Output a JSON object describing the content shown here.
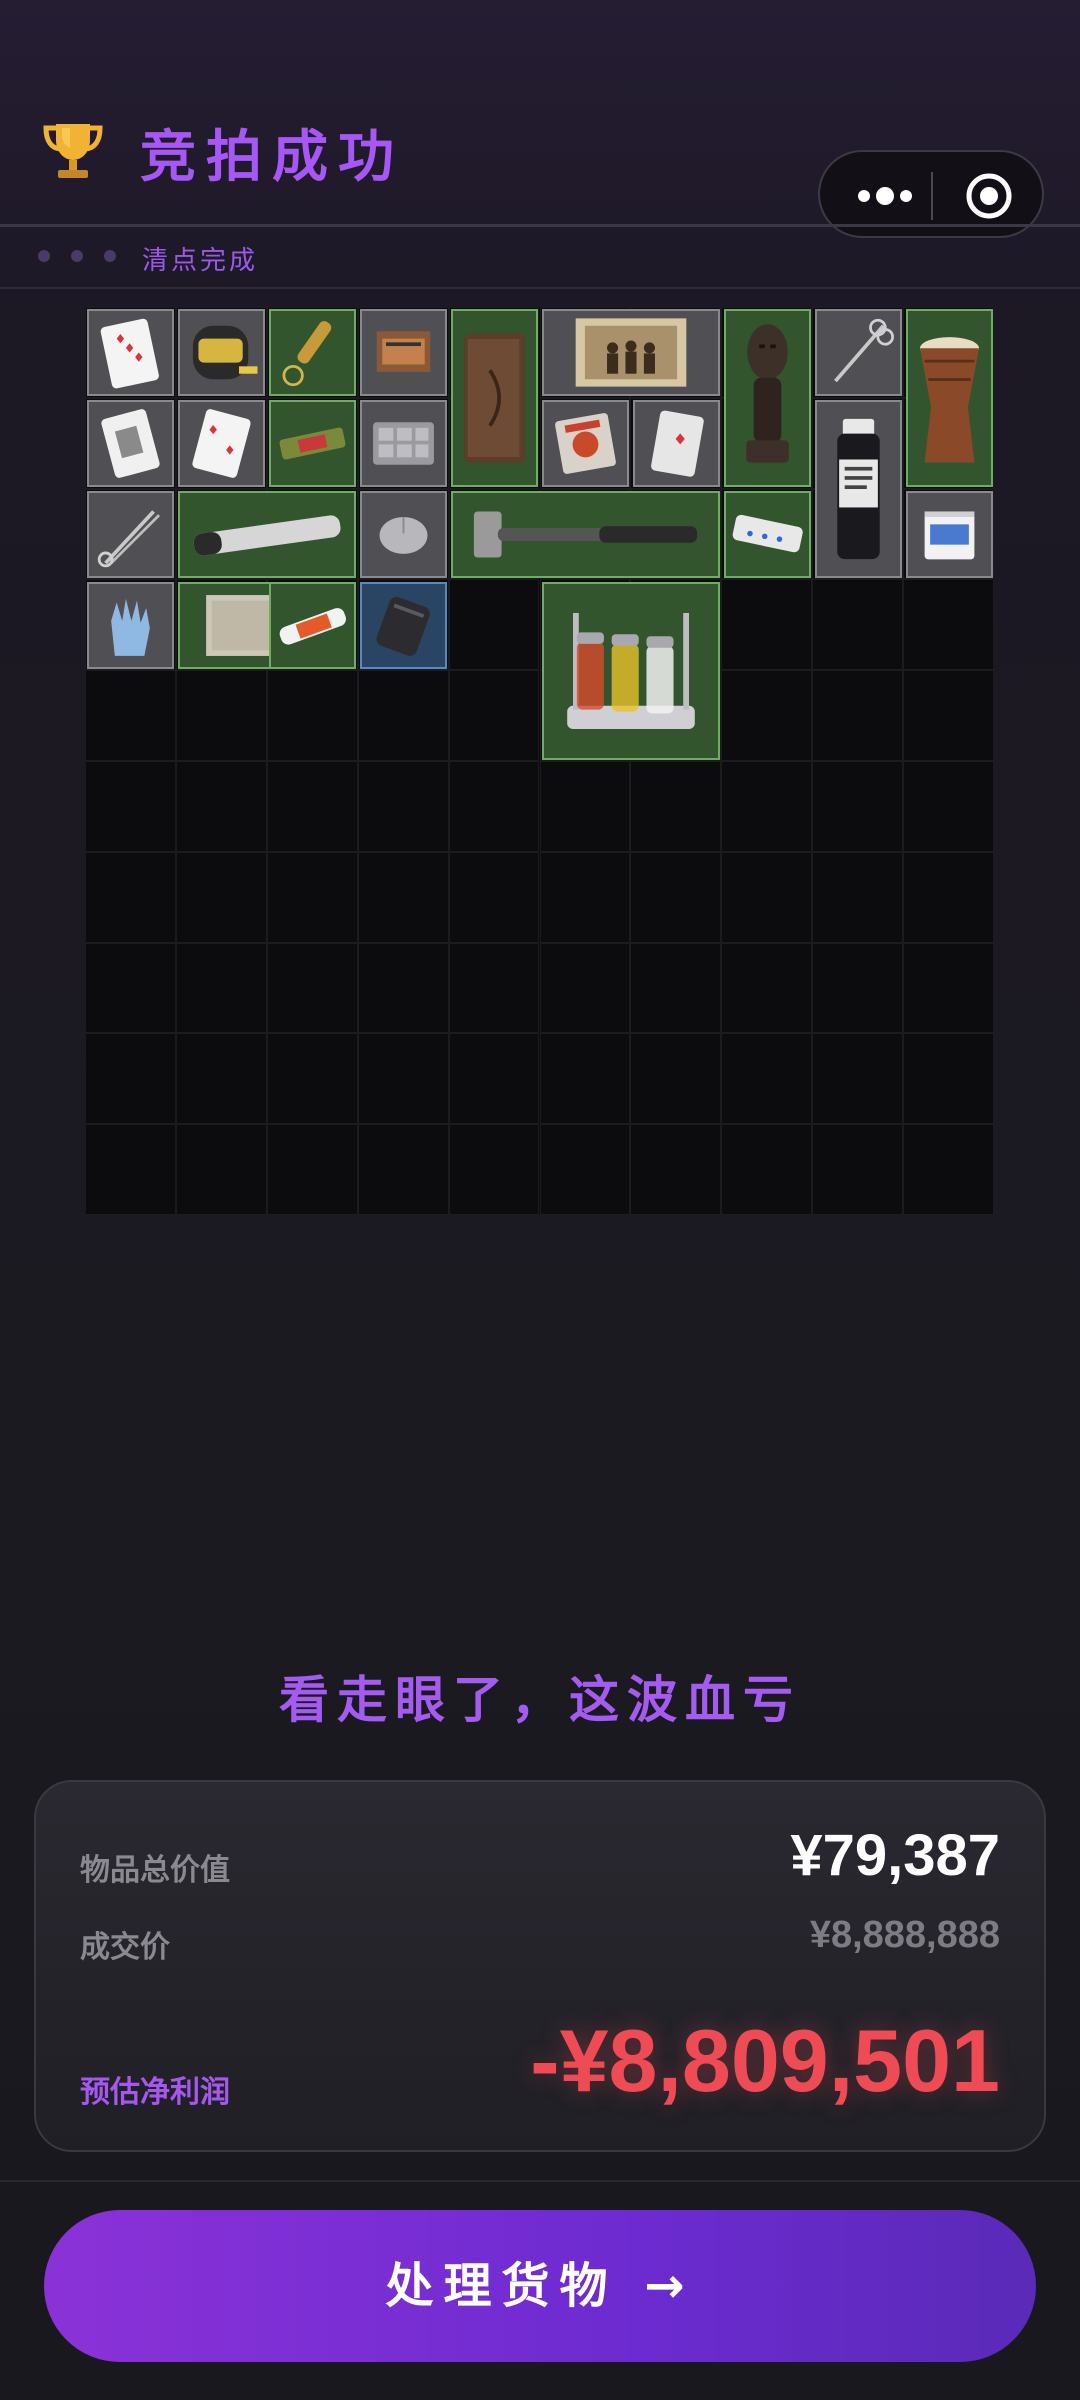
{
  "header": {
    "title": "竞拍成功",
    "subtitle": "清点完成",
    "trophy_icon": "trophy-icon",
    "more_icon": "more-dots-icon",
    "close_icon": "target-close-icon"
  },
  "inventory": {
    "columns": 10,
    "rows": 10,
    "items": [
      {
        "name": "playing-card",
        "rarity": "gray"
      },
      {
        "name": "tape-measure",
        "rarity": "gray"
      },
      {
        "name": "bullet-keychain",
        "rarity": "green"
      },
      {
        "name": "matchbox",
        "rarity": "gray"
      },
      {
        "name": "leather-notebook",
        "rarity": "green"
      },
      {
        "name": "old-photo",
        "rarity": "gray"
      },
      {
        "name": "tribal-statue",
        "rarity": "green"
      },
      {
        "name": "scissors",
        "rarity": "gray"
      },
      {
        "name": "djembe-drum",
        "rarity": "green"
      },
      {
        "name": "playing-card",
        "rarity": "gray"
      },
      {
        "name": "playing-card",
        "rarity": "gray"
      },
      {
        "name": "candy-bar",
        "rarity": "green"
      },
      {
        "name": "plastic-tray",
        "rarity": "gray"
      },
      {
        "name": "snack-packet",
        "rarity": "gray"
      },
      {
        "name": "playing-card",
        "rarity": "gray"
      },
      {
        "name": "medical-sample-bottle",
        "rarity": "gray"
      },
      {
        "name": "forceps",
        "rarity": "gray"
      },
      {
        "name": "flashlight-tube",
        "rarity": "green"
      },
      {
        "name": "computer-mouse",
        "rarity": "gray"
      },
      {
        "name": "hammer",
        "rarity": "green"
      },
      {
        "name": "power-strip",
        "rarity": "green"
      },
      {
        "name": "yogurt-cup",
        "rarity": "gray"
      },
      {
        "name": "rubber-gloves",
        "rarity": "gray"
      },
      {
        "name": "old-parchment",
        "rarity": "green"
      },
      {
        "name": "battery",
        "rarity": "green"
      },
      {
        "name": "power-bank",
        "rarity": "blue"
      },
      {
        "name": "spice-rack",
        "rarity": "green"
      }
    ]
  },
  "result": {
    "verdict": "看走眼了，这波血亏",
    "total_label": "物品总价值",
    "total_value": "¥79,387",
    "deal_label": "成交价",
    "deal_value": "¥8,888,888",
    "profit_label": "预估净利润",
    "profit_value": "-¥8,809,501"
  },
  "colors": {
    "accent": "#a657f5",
    "loss": "#ef4b55",
    "button_start": "#8a32d8",
    "button_end": "#5a2ab8"
  },
  "action": {
    "label": "处理货物 →"
  }
}
